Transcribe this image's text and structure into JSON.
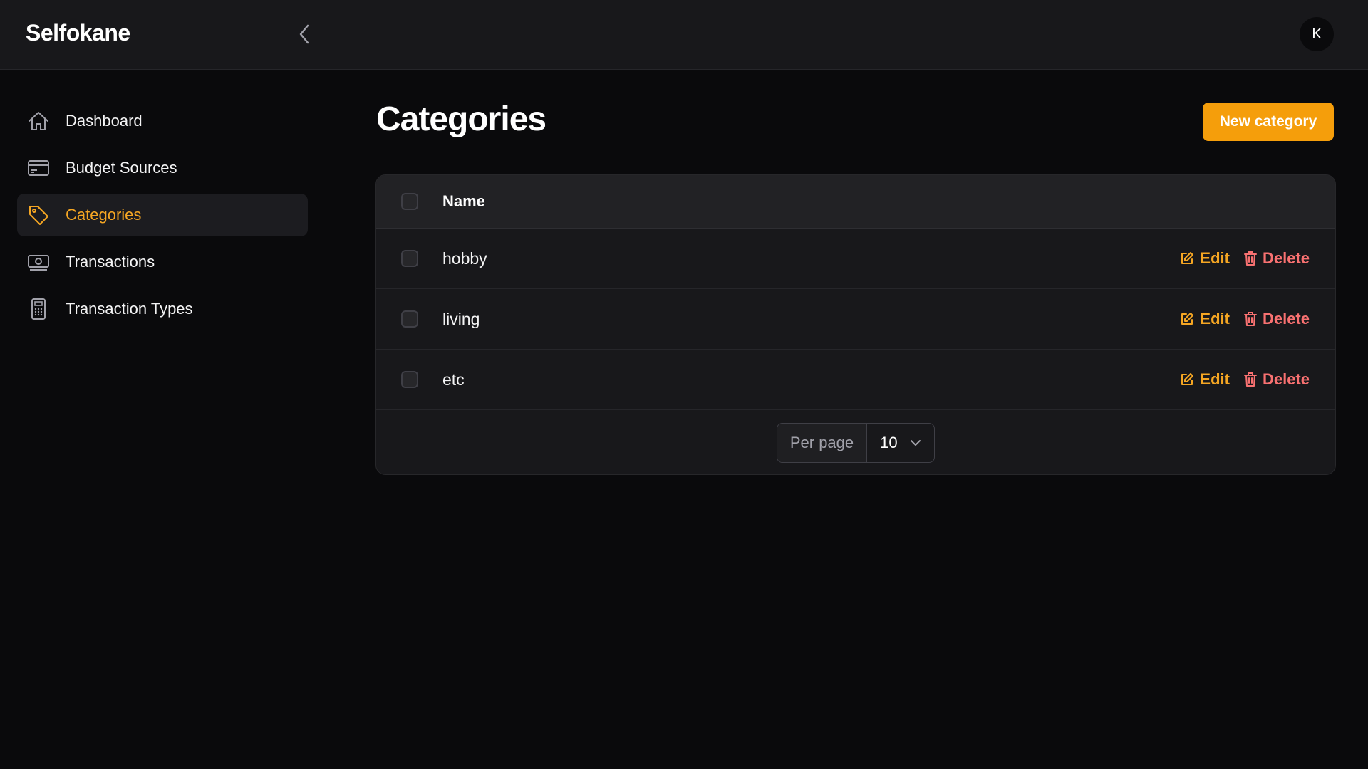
{
  "app": {
    "brand": "Selfokane",
    "avatar_initial": "K"
  },
  "sidebar": {
    "items": [
      {
        "label": "Dashboard",
        "icon": "home-icon",
        "active": false
      },
      {
        "label": "Budget Sources",
        "icon": "credit-card-icon",
        "active": false
      },
      {
        "label": "Categories",
        "icon": "tag-icon",
        "active": true
      },
      {
        "label": "Transactions",
        "icon": "banknote-icon",
        "active": false
      },
      {
        "label": "Transaction Types",
        "icon": "calculator-icon",
        "active": false
      }
    ]
  },
  "header": {
    "title": "Categories",
    "new_button": "New category"
  },
  "table": {
    "columns": [
      "Name"
    ],
    "rows": [
      {
        "name": "hobby"
      },
      {
        "name": "living"
      },
      {
        "name": "etc"
      }
    ],
    "edit_label": "Edit",
    "delete_label": "Delete"
  },
  "pagination": {
    "per_page_label": "Per page",
    "per_page_value": "10"
  },
  "colors": {
    "accent": "#f59e0b",
    "danger": "#f87171",
    "background": "#0a0a0c",
    "surface": "#18181b"
  }
}
